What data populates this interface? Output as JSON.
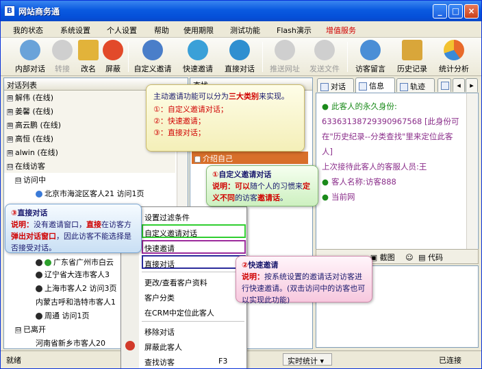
{
  "window": {
    "title": "网站商务通",
    "min_glyph": "_",
    "max_glyph": "□",
    "close_glyph": "×"
  },
  "menu": [
    "我的状态",
    "系统设置",
    "个人设置",
    "帮助",
    "使用期限",
    "测试功能",
    "Flash演示",
    "增值服务"
  ],
  "toolbar": [
    {
      "label": "内部对话",
      "icon": "users-chat-icon",
      "color": "#6aa3d9",
      "disabled": false
    },
    {
      "label": "转接",
      "icon": "transfer-icon",
      "color": "#8a8a8a",
      "disabled": true
    },
    {
      "label": "改名",
      "icon": "rename-card-icon",
      "color": "#e2b33a",
      "disabled": false
    },
    {
      "label": "屏蔽",
      "icon": "block-icon",
      "color": "#e24a2a",
      "disabled": false
    },
    {
      "label": "自定义邀请",
      "icon": "custom-invite-icon",
      "color": "#4a7ec9",
      "disabled": false
    },
    {
      "label": "快速邀请",
      "icon": "quick-invite-icon",
      "color": "#3aa0d8",
      "disabled": false
    },
    {
      "label": "直接对话",
      "icon": "direct-chat-icon",
      "color": "#2f8fd0",
      "disabled": false
    },
    {
      "label": "推送网址",
      "icon": "push-url-icon",
      "color": "#9a9a9a",
      "disabled": true
    },
    {
      "label": "发送文件",
      "icon": "send-file-icon",
      "color": "#9a9a9a",
      "disabled": true
    },
    {
      "label": "访客留言",
      "icon": "visitor-message-icon",
      "color": "#4a8ed6",
      "disabled": false
    },
    {
      "label": "历史记录",
      "icon": "history-icon",
      "color": "#d9a63a",
      "disabled": false
    },
    {
      "label": "统计分析",
      "icon": "stats-chart-icon",
      "color": "#e86a2a",
      "disabled": false
    }
  ],
  "left_panel": {
    "header": "对话列表",
    "rows": [
      {
        "text": "解伟 (在线)",
        "toggle": "⊞",
        "kind": "group"
      },
      {
        "text": "姜馨 (在线)",
        "toggle": "⊞",
        "kind": "group"
      },
      {
        "text": "高云鹏 (在线)",
        "toggle": "⊞",
        "kind": "group"
      },
      {
        "text": "高恒 (在线)",
        "toggle": "⊞",
        "kind": "group"
      },
      {
        "text": "alwin (在线)",
        "toggle": "⊞",
        "kind": "group"
      },
      {
        "text": "在线访客",
        "toggle": "⊟",
        "kind": "group"
      },
      {
        "text": "访问中",
        "toggle": "⊟",
        "kind": "sub"
      },
      {
        "text": "北京市海淀区客人21 访问1页",
        "toggle": "",
        "kind": "visitor"
      },
      {
        "text": "广东省广州市白云",
        "toggle": "",
        "kind": "visitor"
      },
      {
        "text": "辽宁省大连市客人3",
        "toggle": "",
        "kind": "visitor"
      },
      {
        "text": "上海市客人2 访问3页",
        "toggle": "",
        "kind": "visitor"
      },
      {
        "text": "内蒙古呼和浩特市客人1",
        "toggle": "",
        "kind": "visitor"
      },
      {
        "text": "周通 访问1页",
        "toggle": "",
        "kind": "visitor"
      },
      {
        "text": "已离开",
        "toggle": "⊟",
        "kind": "sub"
      },
      {
        "text": "河南省新乡市客人20",
        "toggle": "",
        "kind": "visitor"
      }
    ]
  },
  "mid_panel": {
    "header": "查找",
    "section_toggle": "⊟",
    "section": "介绍自己"
  },
  "right_panel": {
    "tabs": [
      "对话",
      "信息",
      "轨迹"
    ],
    "info": {
      "line1": "此客人的永久身份:",
      "line2": "63363138729390967568 [此身份可在\"历史纪录--分类查找\"里来定位此客人]",
      "line3_prefix": "上次接待此客人的客服人员:王",
      "line4": "客人名称:访客888",
      "line5": "当前网"
    },
    "input_toolbar": [
      "截图",
      "代码"
    ]
  },
  "status": {
    "left": "就绪",
    "mid": "实时统计 ▾",
    "right": "已连接"
  },
  "context_menu": {
    "items": [
      "设置过滤条件",
      "自定义邀请对话",
      "快速邀请",
      "直接对话",
      "更改/查看客户资料",
      "客户分类",
      "在CRM中定位此客人",
      "移除对话",
      "屏蔽此客人",
      "查找访客"
    ],
    "shortcut": "F3"
  },
  "callouts": {
    "yellow": {
      "line1_a": "主动邀请功能可以分为",
      "line1_b": "三大类别",
      "line1_c": "来实现。",
      "item1": "①：自定义邀请对话；",
      "item2": "②：快速邀请；",
      "item3": "③：直接对话；"
    },
    "green": {
      "title_num": "①",
      "title": "自定义邀请对话",
      "label": "说明：",
      "text_a": "可以",
      "text_b": "随个人的习惯来",
      "text_c": "定义不同",
      "text_d": "的访客",
      "text_e": "邀请话",
      "text_f": "。"
    },
    "blue": {
      "title_num": "③",
      "title": "直接对话",
      "label": "说明：",
      "text_a": "没有邀请窗口，",
      "text_b": "直接",
      "text_c": "在访客方",
      "text_d": "弹出对话窗口",
      "text_e": "，因此访客不能选择是否接受对话。"
    },
    "pink": {
      "title_num": "②",
      "title": "快速邀请",
      "label": "说明：",
      "text_a": "按系统设置的邀请话对访客进行快速邀请。",
      "text_b": "(双击访问中的访客也可以实现此功能)"
    }
  }
}
